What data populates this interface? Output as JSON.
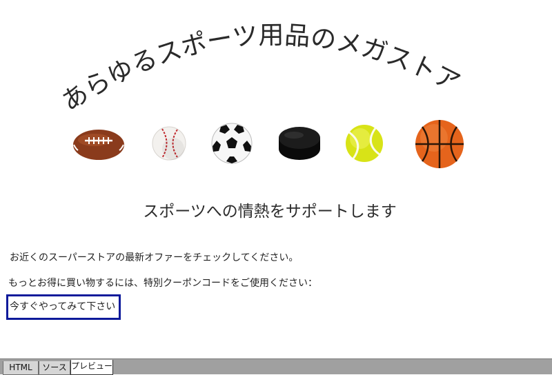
{
  "page": {
    "arc_title": "あらゆるスポーツ用品のメガストア",
    "tagline": "スポーツへの情熱をサポートします",
    "paragraph_1": "お近くのスーパーストアの最新オファーをチェックしてください。",
    "paragraph_2": "もっとお得に買い物するには、特別クーポンコードをご使用ください：",
    "cta_button": "今すぐやってみて下さい",
    "ball_icons": [
      "american-football-icon",
      "baseball-icon",
      "soccer-ball-icon",
      "hockey-puck-icon",
      "tennis-ball-icon",
      "basketball-icon"
    ]
  },
  "tabs": [
    {
      "label": "HTML",
      "active": false
    },
    {
      "label": "ソース",
      "active": false
    },
    {
      "label": "プレビュー",
      "active": true
    }
  ],
  "colors": {
    "cta_border": "#0d1a9a",
    "tabbar_bg": "#a0a0a0"
  }
}
